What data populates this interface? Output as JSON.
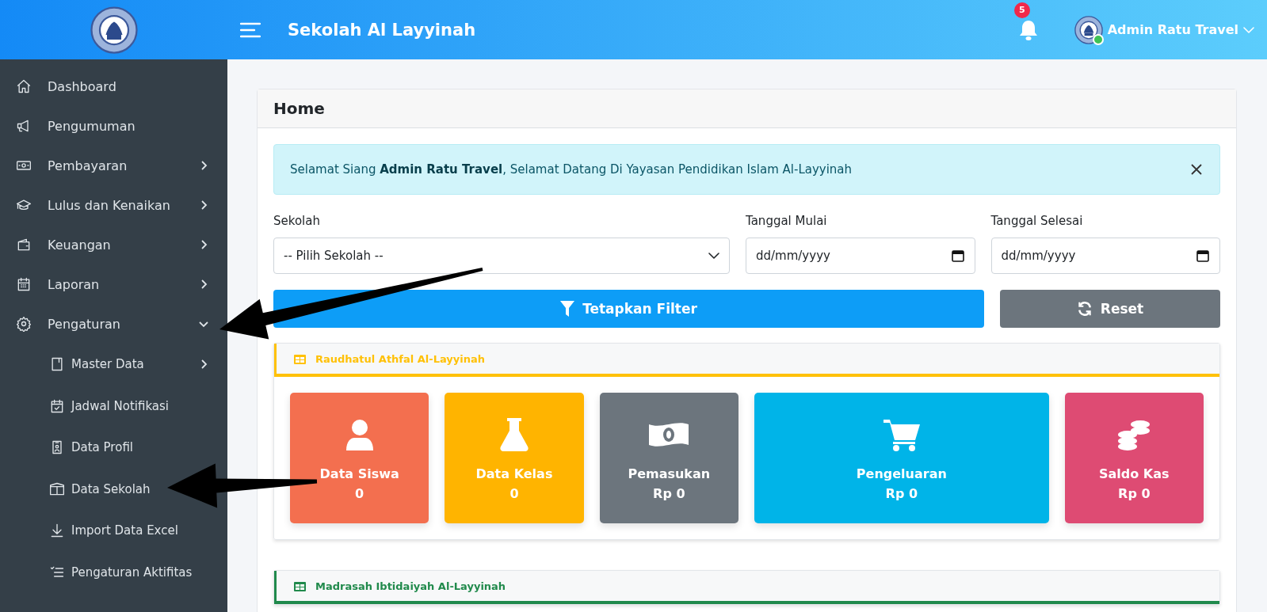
{
  "header": {
    "title": "Sekolah Al Layyinah",
    "notification_count": "5",
    "user": {
      "name": "Admin Ratu Travel",
      "online": true
    }
  },
  "sidebar": {
    "items": [
      {
        "label": "Dashboard"
      },
      {
        "label": "Pengumuman"
      },
      {
        "label": "Pembayaran",
        "expanded": false
      },
      {
        "label": "Lulus dan Kenaikan",
        "expanded": false
      },
      {
        "label": "Keuangan",
        "expanded": false
      },
      {
        "label": "Laporan",
        "expanded": false
      },
      {
        "label": "Pengaturan",
        "expanded": true,
        "children": [
          {
            "label": "Master Data",
            "expanded": false
          },
          {
            "label": "Jadwal Notifikasi"
          },
          {
            "label": "Data Profil"
          },
          {
            "label": "Data Sekolah"
          },
          {
            "label": "Import Data Excel"
          },
          {
            "label": "Pengaturan Aktifitas"
          }
        ]
      }
    ]
  },
  "page": {
    "title": "Home",
    "alert": "Selamat Siang **Admin Ratu Travel**, Selamat Datang Di Yayasan Pendidikan Islam Al-Layyinah",
    "filters": [
      {
        "kind": "select",
        "label": "Sekolah",
        "value": "-- Pilih Sekolah --"
      },
      {
        "kind": "date",
        "label": "Tanggal Mulai",
        "placeholder": "dd/mm/yyyy"
      },
      {
        "kind": "date",
        "label": "Tanggal Selesai",
        "placeholder": "dd/mm/yyyy"
      }
    ],
    "buttons": [
      {
        "kind": "filter",
        "label": "Tetapkan Filter"
      },
      {
        "kind": "reset",
        "label": "Reset"
      }
    ],
    "sections": [
      {
        "title": "Raudhatul Athfal Al-Layyinah",
        "color": "#ffc107",
        "stats": [
          {
            "label": "Data Siswa",
            "value": "0",
            "color": "#f36f4f"
          },
          {
            "label": "Data Kelas",
            "value": "0",
            "color": "#ffb400"
          },
          {
            "label": "Pemasukan",
            "value": "Rp 0",
            "color": "#6c757d"
          },
          {
            "label": "Pengeluaran",
            "value": "Rp 0",
            "color": "#00b4e8"
          },
          {
            "label": "Saldo Kas",
            "value": "Rp 0",
            "color": "#de4b73"
          }
        ]
      },
      {
        "title": "Madrasah Ibtidaiyah Al-Layyinah",
        "color": "#218a4c"
      }
    ]
  }
}
